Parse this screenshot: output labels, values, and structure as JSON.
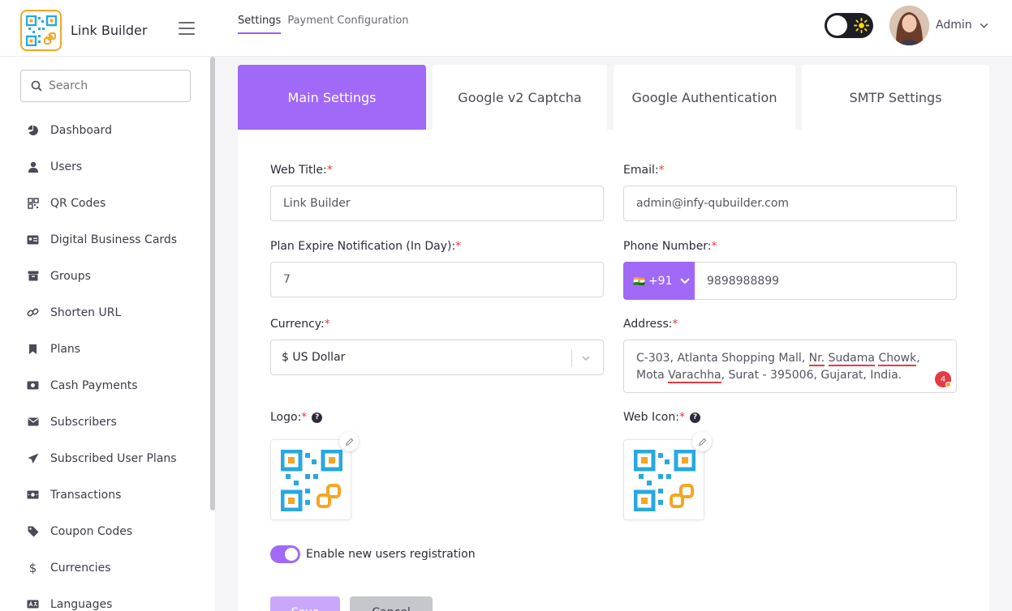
{
  "brand": {
    "name": "Link Builder"
  },
  "header": {
    "tabs": [
      {
        "label": "Settings",
        "active": true
      },
      {
        "label": "Payment Configuration",
        "active": false
      }
    ],
    "user_name": "Admin"
  },
  "sidebar": {
    "search_placeholder": "Search",
    "items": [
      {
        "label": "Dashboard",
        "icon": "dashboard-icon"
      },
      {
        "label": "Users",
        "icon": "user-icon"
      },
      {
        "label": "QR Codes",
        "icon": "qr-code-icon"
      },
      {
        "label": "Digital Business Cards",
        "icon": "id-card-icon"
      },
      {
        "label": "Groups",
        "icon": "box-icon"
      },
      {
        "label": "Shorten URL",
        "icon": "link-icon"
      },
      {
        "label": "Plans",
        "icon": "bookmark-icon"
      },
      {
        "label": "Cash Payments",
        "icon": "cash-icon"
      },
      {
        "label": "Subscribers",
        "icon": "envelope-icon"
      },
      {
        "label": "Subscribed User Plans",
        "icon": "paper-plane-icon"
      },
      {
        "label": "Transactions",
        "icon": "money-icon"
      },
      {
        "label": "Coupon Codes",
        "icon": "tag-icon"
      },
      {
        "label": "Currencies",
        "icon": "dollar-icon"
      },
      {
        "label": "Languages",
        "icon": "language-icon"
      }
    ]
  },
  "settings_tabs": [
    {
      "label": "Main Settings",
      "active": true
    },
    {
      "label": "Google v2 Captcha",
      "active": false
    },
    {
      "label": "Google Authentication",
      "active": false
    },
    {
      "label": "SMTP Settings",
      "active": false
    }
  ],
  "form": {
    "web_title": {
      "label": "Web Title:",
      "required": "*",
      "value": "Link Builder"
    },
    "email": {
      "label": "Email:",
      "required": "*",
      "value": "admin@infy-qubuilder.com"
    },
    "plan_expire": {
      "label": "Plan Expire Notification (In Day):",
      "required": "*",
      "value": "7"
    },
    "phone": {
      "label": "Phone Number:",
      "required": "*",
      "flag": "🇮🇳",
      "dial_code": "+91",
      "value": "9898988899"
    },
    "currency": {
      "label": "Currency:",
      "required": "*",
      "value": "$ US Dollar"
    },
    "address": {
      "label": "Address:",
      "required": "*",
      "line1_parts": [
        "C-303, Atlanta Shopping Mall, ",
        "Nr.",
        " ",
        "Sudama",
        " ",
        "Chowk",
        ","
      ],
      "line2_parts": [
        "Mota ",
        "Varachha",
        ", Surat - 395006, Gujarat, India."
      ],
      "grammar_count": "4"
    },
    "logo": {
      "label": "Logo:",
      "required": "*",
      "help": "?"
    },
    "web_icon": {
      "label": "Web Icon:",
      "required": "*",
      "help": "?"
    },
    "registration": {
      "label": "Enable new users registration",
      "enabled": true
    },
    "save_label": "Save",
    "cancel_label": "Cancel"
  },
  "colors": {
    "accent": "#a069f7",
    "required": "#e53946",
    "qr_blue": "#29a8e0",
    "qr_orange": "#f5a623"
  }
}
